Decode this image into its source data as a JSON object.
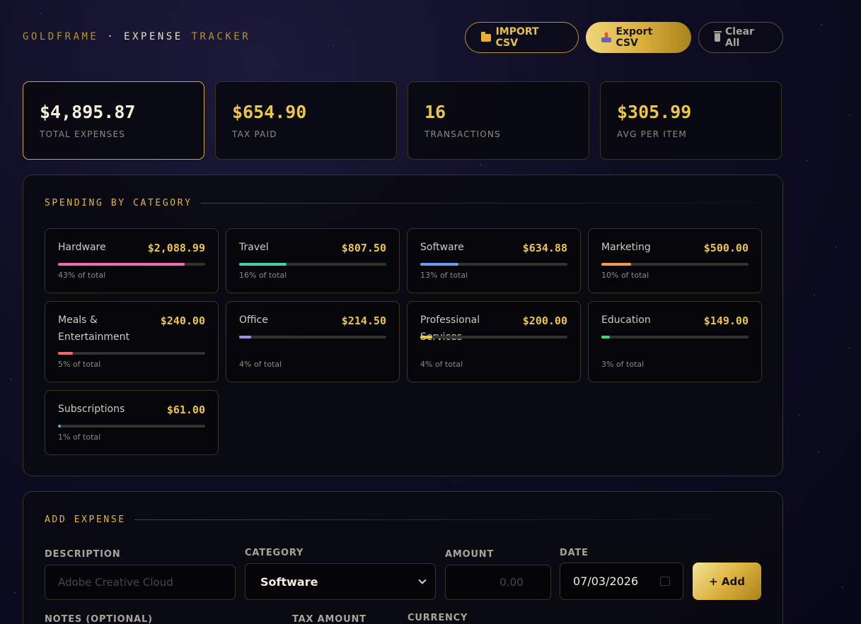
{
  "header": {
    "brand_left": "GOLDFRAME",
    "brand_sep": "·",
    "brand_mid": "EXPENSE",
    "brand_right": "TRACKER",
    "import_label": "IMPORT CSV",
    "export_label": "Export CSV",
    "clear_label": "Clear All",
    "import_icon": "folder-icon",
    "export_icon": "inbox-tray-icon",
    "clear_icon": "wastebasket-icon"
  },
  "stats": [
    {
      "value": "$4,895.87",
      "label": "TOTAL EXPENSES"
    },
    {
      "value": "$654.90",
      "label": "TAX PAID"
    },
    {
      "value": "16",
      "label": "TRANSACTIONS"
    },
    {
      "value": "$305.99",
      "label": "AVG PER ITEM"
    }
  ],
  "categories": {
    "title": "SPENDING BY CATEGORY",
    "items": [
      {
        "name": "Hardware",
        "amount": "$2,088.99",
        "pct_label": "43% of total",
        "pct": 43,
        "color": "#f06ab4"
      },
      {
        "name": "Travel",
        "amount": "$807.50",
        "pct_label": "16% of total",
        "pct": 16,
        "color": "#3ed6a0"
      },
      {
        "name": "Software",
        "amount": "$634.88",
        "pct_label": "13% of total",
        "pct": 13,
        "color": "#6a9cf6"
      },
      {
        "name": "Marketing",
        "amount": "$500.00",
        "pct_label": "10% of total",
        "pct": 10,
        "color": "#f69a4a"
      },
      {
        "name": "Meals & Entertainment",
        "amount": "$240.00",
        "pct_label": "5% of total",
        "pct": 5,
        "color": "#f06a6a"
      },
      {
        "name": "Office",
        "amount": "$214.50",
        "pct_label": "4% of total",
        "pct": 4,
        "color": "#a88af0"
      },
      {
        "name": "Professional Services",
        "amount": "$200.00",
        "pct_label": "4% of total",
        "pct": 4,
        "color": "#f0c83a"
      },
      {
        "name": "Education",
        "amount": "$149.00",
        "pct_label": "3% of total",
        "pct": 3,
        "color": "#3ed680"
      },
      {
        "name": "Subscriptions",
        "amount": "$61.00",
        "pct_label": "1% of total",
        "pct": 1,
        "color": "#4ab4e0"
      }
    ]
  },
  "add_expense": {
    "title": "ADD EXPENSE",
    "description_label": "DESCRIPTION",
    "description_placeholder": "Adobe Creative Cloud",
    "category_label": "CATEGORY",
    "category_value": "Software",
    "amount_label": "AMOUNT",
    "amount_placeholder": "0.00",
    "date_label": "DATE",
    "date_value": "07/03/2026",
    "add_label": "+ Add",
    "notes_label": "NOTES (OPTIONAL)",
    "tax_label": "TAX AMOUNT",
    "currency_label": "CURRENCY"
  }
}
